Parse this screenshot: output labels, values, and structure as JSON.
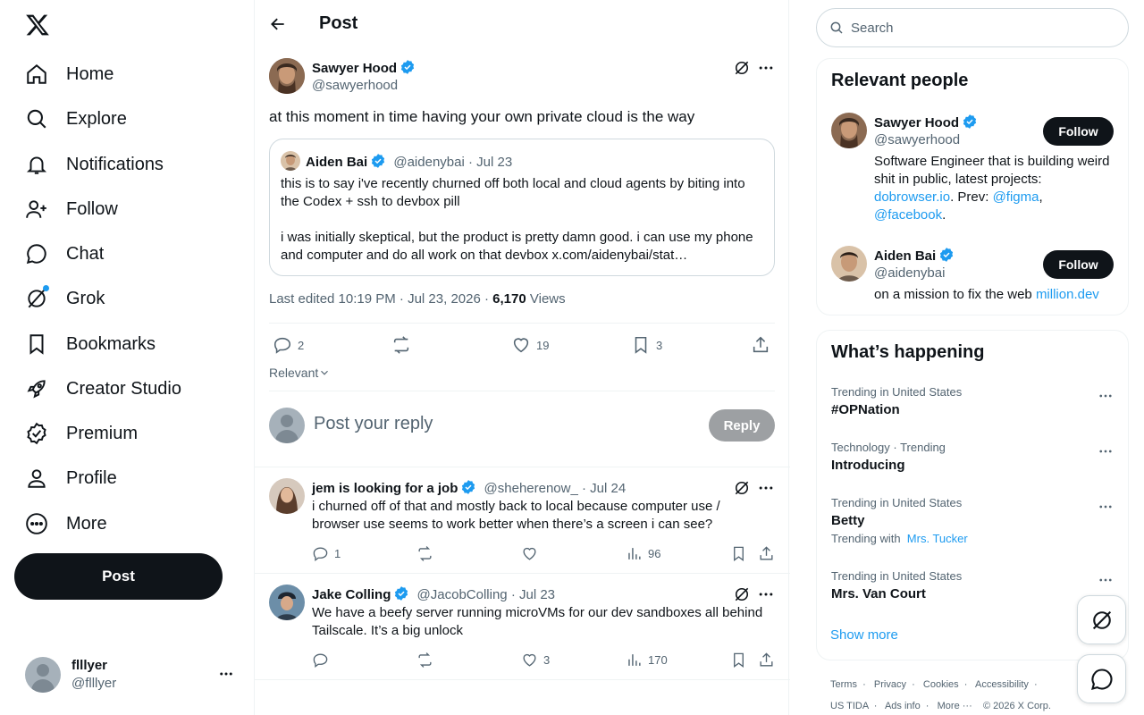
{
  "nav": {
    "items": [
      {
        "label": "Home",
        "icon": "home-icon"
      },
      {
        "label": "Explore",
        "icon": "search-icon"
      },
      {
        "label": "Notifications",
        "icon": "bell-icon"
      },
      {
        "label": "Follow",
        "icon": "person-add-icon"
      },
      {
        "label": "Chat",
        "icon": "chat-icon"
      },
      {
        "label": "Grok",
        "icon": "grok-icon"
      },
      {
        "label": "Bookmarks",
        "icon": "bookmark-icon"
      },
      {
        "label": "Creator Studio",
        "icon": "rocket-icon"
      },
      {
        "label": "Premium",
        "icon": "verified-badge-icon"
      },
      {
        "label": "Profile",
        "icon": "person-icon"
      },
      {
        "label": "More",
        "icon": "more-circle-icon"
      }
    ],
    "post_label": "Post"
  },
  "account": {
    "name": "flllyer",
    "handle": "@flllyer"
  },
  "header": {
    "title": "Post"
  },
  "tweet": {
    "author_name": "Sawyer Hood",
    "author_handle": "@sawyerhood",
    "text": "at this moment in time having your own private cloud is the way",
    "quote": {
      "author_name": "Aiden Bai",
      "author_handle": "@aidenybai",
      "date": "Jul 23",
      "text1": "this is to say i've recently churned off both local and cloud agents by biting into the Codex + ssh to devbox pill",
      "text2": "i was initially skeptical, but the product is pretty damn good. i can use my phone and computer and do all work on that devbox x.com/aidenybai/stat…"
    },
    "edited": "Last edited 10:19 PM · Jul 23, 2026 · ",
    "views_count": "6,170",
    "views_label": "Views",
    "replies": "2",
    "likes": "19",
    "bookmarks": "3",
    "sort_label": "Relevant"
  },
  "reply_box": {
    "placeholder": "Post your reply",
    "button": "Reply"
  },
  "replies": [
    {
      "name": "jem is looking for a job",
      "handle": "@sheherenow_",
      "date": "· Jul 24",
      "text": "i churned off of that and mostly back to local because computer use / browser use seems to work better when there’s a screen i can see?",
      "reply_count": "1",
      "retweets": "",
      "likes": "",
      "views": "96"
    },
    {
      "name": "Jake Colling",
      "handle": "@JacobColling",
      "date": "· Jul 23",
      "text": "We have a beefy server running microVMs for our dev sandboxes all behind Tailscale. It’s a big unlock",
      "reply_count": "",
      "retweets": "",
      "likes": "3",
      "views": "170"
    }
  ],
  "search": {
    "placeholder": "Search"
  },
  "relevant_people": {
    "title": "Relevant people",
    "people": [
      {
        "name": "Sawyer Hood",
        "handle": "@sawyerhood",
        "follow": "Follow",
        "bio_a": "Software Engineer that is building weird shit in public, latest projects: ",
        "bio_link1": "dobrowser.io",
        "bio_b": ". Prev: ",
        "bio_link2": "@figma",
        "bio_c": ", ",
        "bio_link3": "@facebook",
        "bio_d": "."
      },
      {
        "name": "Aiden Bai",
        "handle": "@aidenybai",
        "follow": "Follow",
        "bio_a": "on a mission to fix the web ",
        "bio_link1": "million.dev"
      }
    ]
  },
  "trends": {
    "title": "What’s happening",
    "items": [
      {
        "context": "Trending in United States",
        "name": "#OPNation"
      },
      {
        "context": "Technology · Trending",
        "name": "Introducing"
      },
      {
        "context": "Trending in United States",
        "name": "Betty",
        "with_label": "Trending with",
        "with_link": "Mrs. Tucker"
      },
      {
        "context": "Trending in United States",
        "name": "Mrs. Van Court"
      }
    ],
    "show_more": "Show more"
  },
  "footer": {
    "links1": [
      "Terms",
      "Privacy",
      "Cookies",
      "Accessibility"
    ],
    "links2": [
      "US TIDA",
      "Ads info",
      "More ···"
    ],
    "copyright": "© 2026 X Corp."
  },
  "colors": {
    "accent": "#1d9bf0",
    "text": "#0f1419",
    "muted": "#536471"
  }
}
